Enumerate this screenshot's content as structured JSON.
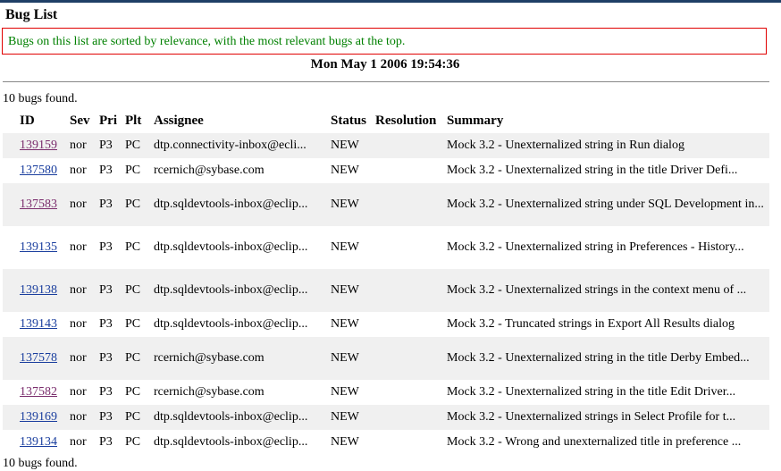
{
  "page": {
    "title": "Bug List",
    "notice": "Bugs on this list are sorted by relevance, with the most relevant bugs at the top.",
    "timestamp": "Mon May 1 2006 19:54:36",
    "count_top": "10 bugs found.",
    "count_bottom": "10 bugs found."
  },
  "table": {
    "headers": {
      "id": "ID",
      "sev": "Sev",
      "pri": "Pri",
      "plt": "Plt",
      "assignee": "Assignee",
      "status": "Status",
      "resolution": "Resolution",
      "summary": "Summary"
    },
    "rows": [
      {
        "id": "139159",
        "visited": true,
        "sev": "nor",
        "pri": "P3",
        "plt": "PC",
        "assignee": "dtp.connectivity-inbox@ecli...",
        "status": "NEW",
        "resolution": "",
        "summary": "Mock 3.2 - Unexternalized string in Run dialog"
      },
      {
        "id": "137580",
        "visited": false,
        "sev": "nor",
        "pri": "P3",
        "plt": "PC",
        "assignee": "rcernich@sybase.com",
        "status": "NEW",
        "resolution": "",
        "summary": "Mock 3.2 - Unexternalized string in the title Driver Defi..."
      },
      {
        "id": "137583",
        "visited": true,
        "sev": "nor",
        "pri": "P3",
        "plt": "PC",
        "assignee": "dtp.sqldevtools-inbox@eclip...",
        "status": "NEW",
        "resolution": "",
        "summary": "Mock 3.2 - Unexternalized string under SQL Development in..."
      },
      {
        "id": "139135",
        "visited": false,
        "sev": "nor",
        "pri": "P3",
        "plt": "PC",
        "assignee": "dtp.sqldevtools-inbox@eclip...",
        "status": "NEW",
        "resolution": "",
        "summary": "Mock 3.2 - Unexternalized string in Preferences - History..."
      },
      {
        "id": "139138",
        "visited": false,
        "sev": "nor",
        "pri": "P3",
        "plt": "PC",
        "assignee": "dtp.sqldevtools-inbox@eclip...",
        "status": "NEW",
        "resolution": "",
        "summary": "Mock 3.2 - Unexternalized strings in the context menu of ..."
      },
      {
        "id": "139143",
        "visited": false,
        "sev": "nor",
        "pri": "P3",
        "plt": "PC",
        "assignee": "dtp.sqldevtools-inbox@eclip...",
        "status": "NEW",
        "resolution": "",
        "summary": "Mock 3.2 - Truncated strings in Export All Results dialog"
      },
      {
        "id": "137578",
        "visited": false,
        "sev": "nor",
        "pri": "P3",
        "plt": "PC",
        "assignee": "rcernich@sybase.com",
        "status": "NEW",
        "resolution": "",
        "summary": "Mock 3.2 - Unexternalized string in the title Derby Embed..."
      },
      {
        "id": "137582",
        "visited": true,
        "sev": "nor",
        "pri": "P3",
        "plt": "PC",
        "assignee": "rcernich@sybase.com",
        "status": "NEW",
        "resolution": "",
        "summary": "Mock 3.2 - Unexternalized string in the title Edit Driver..."
      },
      {
        "id": "139169",
        "visited": false,
        "sev": "nor",
        "pri": "P3",
        "plt": "PC",
        "assignee": "dtp.sqldevtools-inbox@eclip...",
        "status": "NEW",
        "resolution": "",
        "summary": "Mock 3.2 - Unexternalized strings in Select Profile for t..."
      },
      {
        "id": "139134",
        "visited": false,
        "sev": "nor",
        "pri": "P3",
        "plt": "PC",
        "assignee": "dtp.sqldevtools-inbox@eclip...",
        "status": "NEW",
        "resolution": "",
        "summary": "Mock 3.2 - Wrong and unexternalized title in preference ..."
      }
    ]
  },
  "colors": {
    "link": "#1a3e9e",
    "visited_link": "#7a2c6c",
    "notice_text": "#008000",
    "notice_border": "#e00000",
    "row_shade": "#f0f0f0"
  }
}
